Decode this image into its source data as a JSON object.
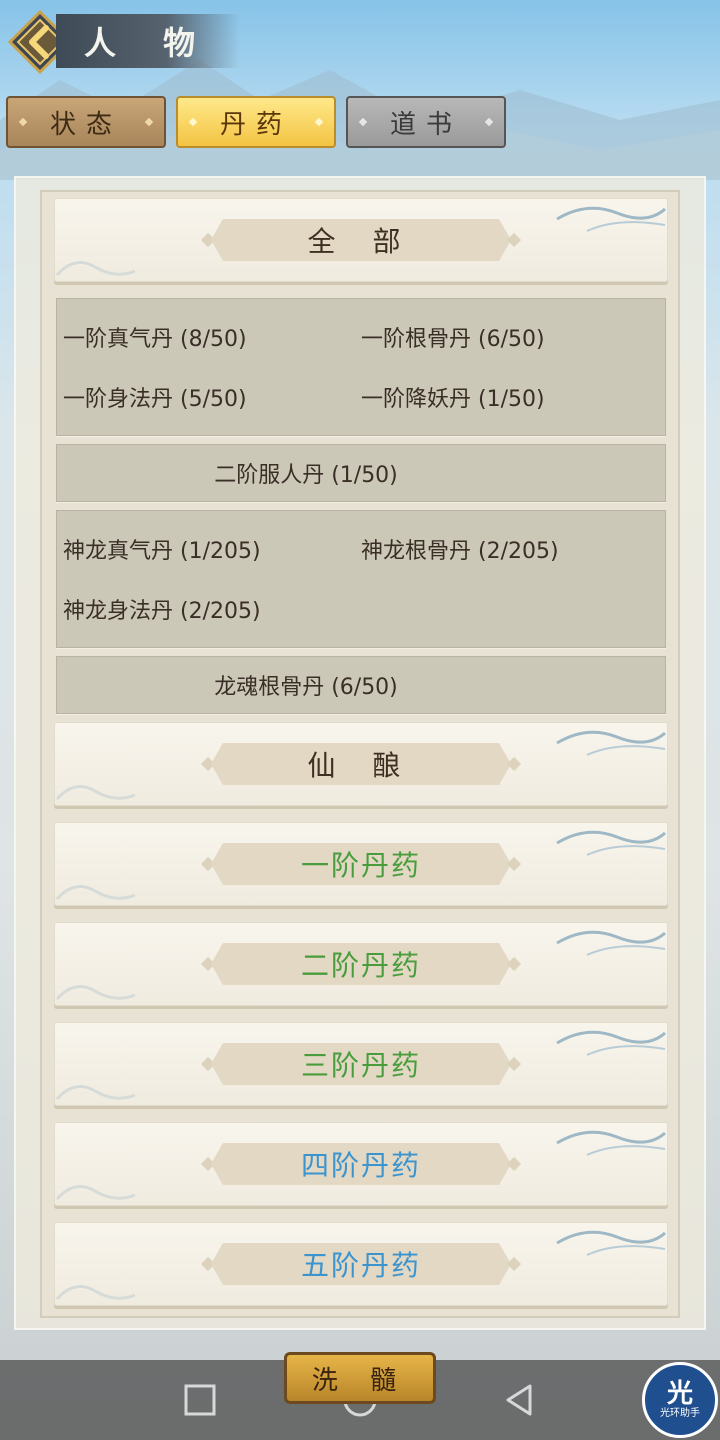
{
  "header": {
    "title": "人 物"
  },
  "tabs": [
    {
      "label": "状态",
      "state": "inactive"
    },
    {
      "label": "丹药",
      "state": "active"
    },
    {
      "label": "道书",
      "state": "disabled"
    }
  ],
  "categories": {
    "all": "全 部",
    "xianniang": "仙 酿",
    "tier1": "一阶丹药",
    "tier2": "二阶丹药",
    "tier3": "三阶丹药",
    "tier4": "四阶丹药",
    "tier5": "五阶丹药"
  },
  "groups": [
    {
      "items": [
        "一阶真气丹 (8/50)",
        "一阶根骨丹 (6/50)",
        "一阶身法丹 (5/50)",
        "一阶降妖丹 (1/50)"
      ]
    },
    {
      "items": [
        "二阶服人丹 (1/50)"
      ]
    },
    {
      "items": [
        "神龙真气丹 (1/205)",
        "神龙根骨丹 (2/205)",
        "神龙身法丹 (2/205)"
      ]
    },
    {
      "items": [
        "龙魂根骨丹 (6/50)"
      ]
    }
  ],
  "footer": {
    "wash_button": "洗 髓"
  },
  "assistant": {
    "glyph": "光",
    "label": "光环助手"
  },
  "colors": {
    "green": "#4a9d3c",
    "blue": "#3c94cf",
    "gold": "#f3c443"
  }
}
